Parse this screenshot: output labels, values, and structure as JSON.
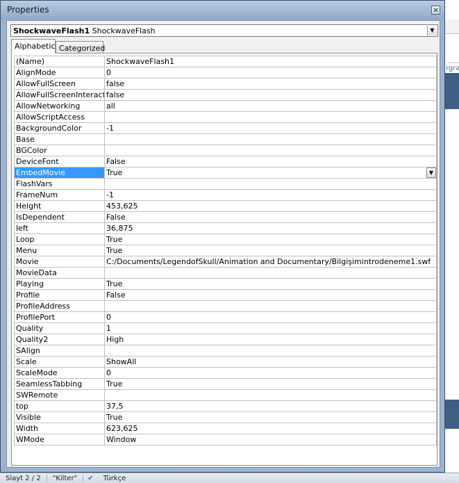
{
  "window": {
    "title": "Properties",
    "close_glyph": "✕"
  },
  "object_selector": {
    "name": "ShockwaveFlash1",
    "type": "ShockwaveFlash"
  },
  "tabs": [
    {
      "label": "Alphabetic",
      "active": true
    },
    {
      "label": "Categorized",
      "active": false
    }
  ],
  "selected_property": "EmbedMovie",
  "properties": [
    {
      "name": "(Name)",
      "value": "ShockwaveFlash1"
    },
    {
      "name": "AlignMode",
      "value": "0"
    },
    {
      "name": "AllowFullScreen",
      "value": "false"
    },
    {
      "name": "AllowFullScreenInteractive",
      "value": "false"
    },
    {
      "name": "AllowNetworking",
      "value": "all"
    },
    {
      "name": "AllowScriptAccess",
      "value": ""
    },
    {
      "name": "BackgroundColor",
      "value": "-1"
    },
    {
      "name": "Base",
      "value": ""
    },
    {
      "name": "BGColor",
      "value": ""
    },
    {
      "name": "DeviceFont",
      "value": "False"
    },
    {
      "name": "EmbedMovie",
      "value": "True"
    },
    {
      "name": "FlashVars",
      "value": ""
    },
    {
      "name": "FrameNum",
      "value": "-1"
    },
    {
      "name": "Height",
      "value": "453,625"
    },
    {
      "name": "IsDependent",
      "value": "False"
    },
    {
      "name": "left",
      "value": "36,875"
    },
    {
      "name": "Loop",
      "value": "True"
    },
    {
      "name": "Menu",
      "value": "True"
    },
    {
      "name": "Movie",
      "value": "C:/Documents/LegendofSkull/Animation and Documentary/Bilgişimintrodeneme1.swf"
    },
    {
      "name": "MovieData",
      "value": ""
    },
    {
      "name": "Playing",
      "value": "True"
    },
    {
      "name": "Profile",
      "value": "False"
    },
    {
      "name": "ProfileAddress",
      "value": ""
    },
    {
      "name": "ProfilePort",
      "value": "0"
    },
    {
      "name": "Quality",
      "value": "1"
    },
    {
      "name": "Quality2",
      "value": "High"
    },
    {
      "name": "SAlign",
      "value": ""
    },
    {
      "name": "Scale",
      "value": "ShowAll"
    },
    {
      "name": "ScaleMode",
      "value": "0"
    },
    {
      "name": "SeamlessTabbing",
      "value": "True"
    },
    {
      "name": "SWRemote",
      "value": ""
    },
    {
      "name": "top",
      "value": "37,5"
    },
    {
      "name": "Visible",
      "value": "True"
    },
    {
      "name": "Width",
      "value": "623,625"
    },
    {
      "name": "WMode",
      "value": "Window"
    }
  ],
  "status_bar": {
    "slide": "Slayt 2 / 2",
    "theme": "\"Kilter\"",
    "language": "Türkçe"
  },
  "background_app": {
    "partial_text": "rgraf"
  }
}
